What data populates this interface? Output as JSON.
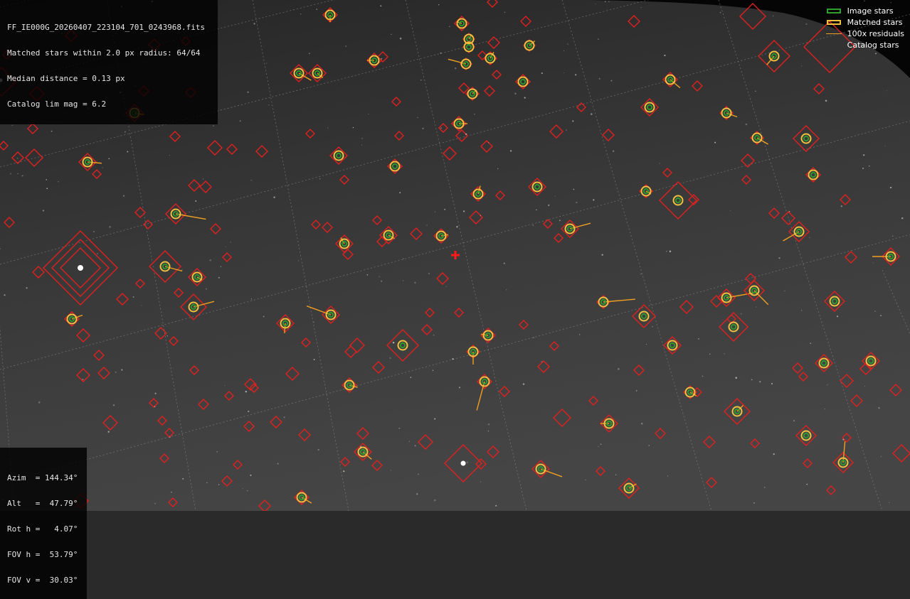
{
  "header": {
    "filename": "FF_IE000G_20260407_223104_701_0243968.fits",
    "matched_line": "Matched stars within 2.0 px radius: 64/64",
    "median_line": "Median distance = 0.13 px",
    "limmag_line": "Catalog lim mag = 6.2"
  },
  "legend": {
    "image_stars": "Image stars",
    "matched_stars": "Matched stars",
    "residuals": "100x residuals",
    "catalog_stars": "Catalog stars"
  },
  "pointing": {
    "azim": "Azim  = 144.34°",
    "alt": "Alt   =  47.79°",
    "rot": "Rot h =   4.07°",
    "fov_h": "FOV h =  53.79°",
    "fov_v": "FOV v =  30.03°"
  },
  "colors": {
    "image_star": "#2e9e2e",
    "matched_star": "#f0c040",
    "residual": "#f0a020",
    "catalog_star": "#e02020",
    "grid": "#9a9a9a",
    "center_marker": "#ff1a1a"
  },
  "icons": {
    "center": "red-cross-icon"
  }
}
